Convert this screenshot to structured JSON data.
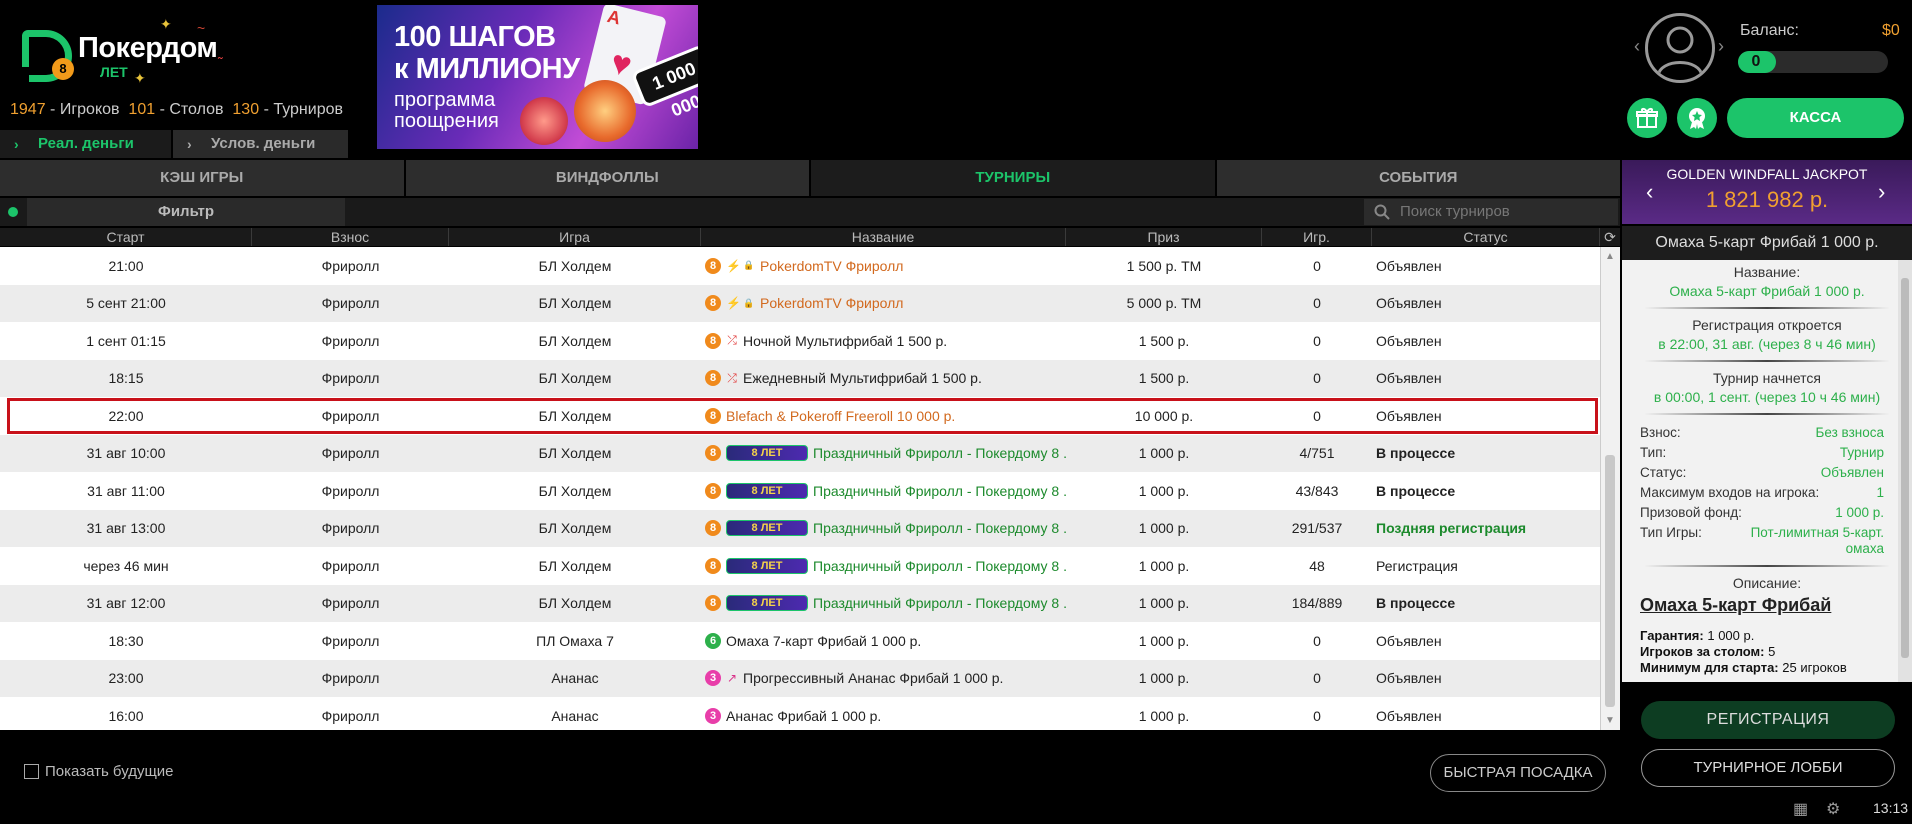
{
  "brand": {
    "name": "Покердом",
    "years_badge": "8",
    "years_text": "ЛЕТ"
  },
  "stats": {
    "players": "1947",
    "players_label": "- Игроков",
    "tables": "101",
    "tables_label": "- Столов",
    "tournaments": "130",
    "tournaments_label": "- Турниров"
  },
  "money_tabs": [
    {
      "label": "Реал. деньги"
    },
    {
      "label": "Услов. деньги"
    }
  ],
  "banner": {
    "title_line1": "100 ШАГОВ",
    "title_line2": "к МИЛЛИОНУ",
    "sub_line1": "программа",
    "sub_line2": "поощрения",
    "card_letter": "A",
    "chip_text": "1 000 000"
  },
  "account": {
    "balance_label": "Баланс:",
    "balance_value": "$0",
    "level": "0",
    "level_progress": 0.25,
    "cashier_label": "КАССА"
  },
  "main_tabs": [
    {
      "label": "КЭШ ИГРЫ"
    },
    {
      "label": "ВИНДФОЛЛЫ"
    },
    {
      "label": "ТУРНИРЫ"
    },
    {
      "label": "СОБЫТИЯ"
    }
  ],
  "filter": {
    "label": "Фильтр",
    "search_placeholder": "Поиск турниров"
  },
  "columns": [
    "Старт",
    "Взнос",
    "Игра",
    "Название",
    "Приз",
    "Игр.",
    "Статус"
  ],
  "rows": [
    {
      "start": "21:00",
      "fee": "Фриролл",
      "game": "БЛ Холдем",
      "badge": "8",
      "badge_color": "#f08a1c",
      "icons": [
        "lightning",
        "lock"
      ],
      "name": "PokerdomTV Фриролл",
      "name_style": "orange",
      "prize": "1 500 р. ТМ",
      "players": "0",
      "status": "Объявлен",
      "status_style": "normal"
    },
    {
      "start": "5 сент 21:00",
      "fee": "Фриролл",
      "game": "БЛ Холдем",
      "badge": "8",
      "badge_color": "#f08a1c",
      "icons": [
        "lightning",
        "lock"
      ],
      "name": "PokerdomTV Фриролл",
      "name_style": "orange",
      "prize": "5 000 р. ТМ",
      "players": "0",
      "status": "Объявлен",
      "status_style": "normal"
    },
    {
      "start": "1 сент 01:15",
      "fee": "Фриролл",
      "game": "БЛ Холдем",
      "badge": "8",
      "badge_color": "#f08a1c",
      "icons": [
        "shuffle"
      ],
      "name": "Ночной Мультифрибай 1 500 р.",
      "name_style": "normal",
      "prize": "1 500 р.",
      "players": "0",
      "status": "Объявлен",
      "status_style": "normal"
    },
    {
      "start": "18:15",
      "fee": "Фриролл",
      "game": "БЛ Холдем",
      "badge": "8",
      "badge_color": "#f08a1c",
      "icons": [
        "shuffle"
      ],
      "name": "Ежедневный Мультифрибай 1 500 р.",
      "name_style": "normal",
      "prize": "1 500 р.",
      "players": "0",
      "status": "Объявлен",
      "status_style": "normal"
    },
    {
      "start": "22:00",
      "fee": "Фриролл",
      "game": "БЛ Холдем",
      "badge": "8",
      "badge_color": "#f08a1c",
      "icons": [],
      "name": "Blefach & Pokeroff Freeroll 10 000 р.",
      "name_style": "orange",
      "prize": "10 000 р.",
      "players": "0",
      "status": "Объявлен",
      "status_style": "normal",
      "selected": true
    },
    {
      "start": "31 авг 10:00",
      "fee": "Фриролл",
      "game": "БЛ Холдем",
      "badge": "8",
      "badge_color": "#f08a1c",
      "icons": [
        "promo"
      ],
      "promo_text": "8 ЛЕТ",
      "name": "Праздничный Фриролл - Покердому 8 ...",
      "name_style": "green",
      "prize": "1 000 р.",
      "players": "4/751",
      "status": "В процессе",
      "status_style": "bold"
    },
    {
      "start": "31 авг 11:00",
      "fee": "Фриролл",
      "game": "БЛ Холдем",
      "badge": "8",
      "badge_color": "#f08a1c",
      "icons": [
        "promo"
      ],
      "promo_text": "8 ЛЕТ",
      "name": "Праздничный Фриролл - Покердому 8 ...",
      "name_style": "green",
      "prize": "1 000 р.",
      "players": "43/843",
      "status": "В процессе",
      "status_style": "bold"
    },
    {
      "start": "31 авг 13:00",
      "fee": "Фриролл",
      "game": "БЛ Холдем",
      "badge": "8",
      "badge_color": "#f08a1c",
      "icons": [
        "promo"
      ],
      "promo_text": "8 ЛЕТ",
      "name": "Праздничный Фриролл - Покердому 8 ...",
      "name_style": "green",
      "prize": "1 000 р.",
      "players": "291/537",
      "status": "Поздняя регистрация",
      "status_style": "green"
    },
    {
      "start": "через 46 мин",
      "fee": "Фриролл",
      "game": "БЛ Холдем",
      "badge": "8",
      "badge_color": "#f08a1c",
      "icons": [
        "promo"
      ],
      "promo_text": "8 ЛЕТ",
      "name": "Праздничный Фриролл - Покердому 8 ...",
      "name_style": "green",
      "prize": "1 000 р.",
      "players": "48",
      "status": "Регистрация",
      "status_style": "normal"
    },
    {
      "start": "31 авг 12:00",
      "fee": "Фриролл",
      "game": "БЛ Холдем",
      "badge": "8",
      "badge_color": "#f08a1c",
      "icons": [
        "promo"
      ],
      "promo_text": "8 ЛЕТ",
      "name": "Праздничный Фриролл - Покердому 8 ...",
      "name_style": "green",
      "prize": "1 000 р.",
      "players": "184/889",
      "status": "В процессе",
      "status_style": "bold"
    },
    {
      "start": "18:30",
      "fee": "Фриролл",
      "game": "ПЛ Омаха 7",
      "badge": "6",
      "badge_color": "#2db04b",
      "icons": [],
      "name": "Омаха 7-карт Фрибай 1 000 р.",
      "name_style": "normal",
      "prize": "1 000 р.",
      "players": "0",
      "status": "Объявлен",
      "status_style": "normal"
    },
    {
      "start": "23:00",
      "fee": "Фриролл",
      "game": "Ананас",
      "badge": "3",
      "badge_color": "#e83ea9",
      "icons": [
        "progressive"
      ],
      "name": "Прогрессивный Ананас Фрибай 1 000 р.",
      "name_style": "normal",
      "prize": "1 000 р.",
      "players": "0",
      "status": "Объявлен",
      "status_style": "normal"
    },
    {
      "start": "16:00",
      "fee": "Фриролл",
      "game": "Ананас",
      "badge": "3",
      "badge_color": "#e83ea9",
      "icons": [],
      "name": "Ананас Фрибай 1 000 р.",
      "name_style": "normal",
      "prize": "1 000 р.",
      "players": "0",
      "status": "Объявлен",
      "status_style": "normal"
    }
  ],
  "bottom": {
    "show_future_label": "Показать будущие",
    "quick_seat_label": "БЫСТРАЯ ПОСАДКА"
  },
  "jackpot": {
    "title": "GOLDEN WINDFALL JACKPOT",
    "value": "1 821 982 р."
  },
  "details": {
    "title": "Омаха 5-карт Фрибай 1 000 р.",
    "name_label": "Название:",
    "name_value": "Омаха 5-карт Фрибай 1 000 р.",
    "reg_opens_label": "Регистрация откроется",
    "reg_opens_value": "в 22:00, 31 авг. (через 8 ч 46 мин)",
    "start_label": "Турнир начнется",
    "start_value": "в 00:00, 1 сент. (через 10 ч 46 мин)",
    "kv": [
      {
        "k": "Взнос:",
        "v": "Без взноса"
      },
      {
        "k": "Тип:",
        "v": "Турнир"
      },
      {
        "k": "Статус:",
        "v": "Объявлен"
      },
      {
        "k": "Максимум входов на игрока:",
        "v": "1"
      },
      {
        "k": "Призовой фонд:",
        "v": "1 000 р."
      },
      {
        "k": "Тип Игры:",
        "v": "Пот-лимитная 5-карт. омаха"
      }
    ],
    "desc_label": "Описание:",
    "desc_head": "Омаха 5-карт Фрибай",
    "guarantee_label": "Гарантия:",
    "guarantee_value": "1 000 р.",
    "per_table_label": "Игроков за столом:",
    "per_table_value": "5",
    "min_start_label": "Минимум для старта:",
    "min_start_value": "25 игроков"
  },
  "actions": {
    "register_label": "РЕГИСТРАЦИЯ",
    "lobby_label": "ТУРНИРНОЕ ЛОББИ"
  },
  "clock": "13:13"
}
